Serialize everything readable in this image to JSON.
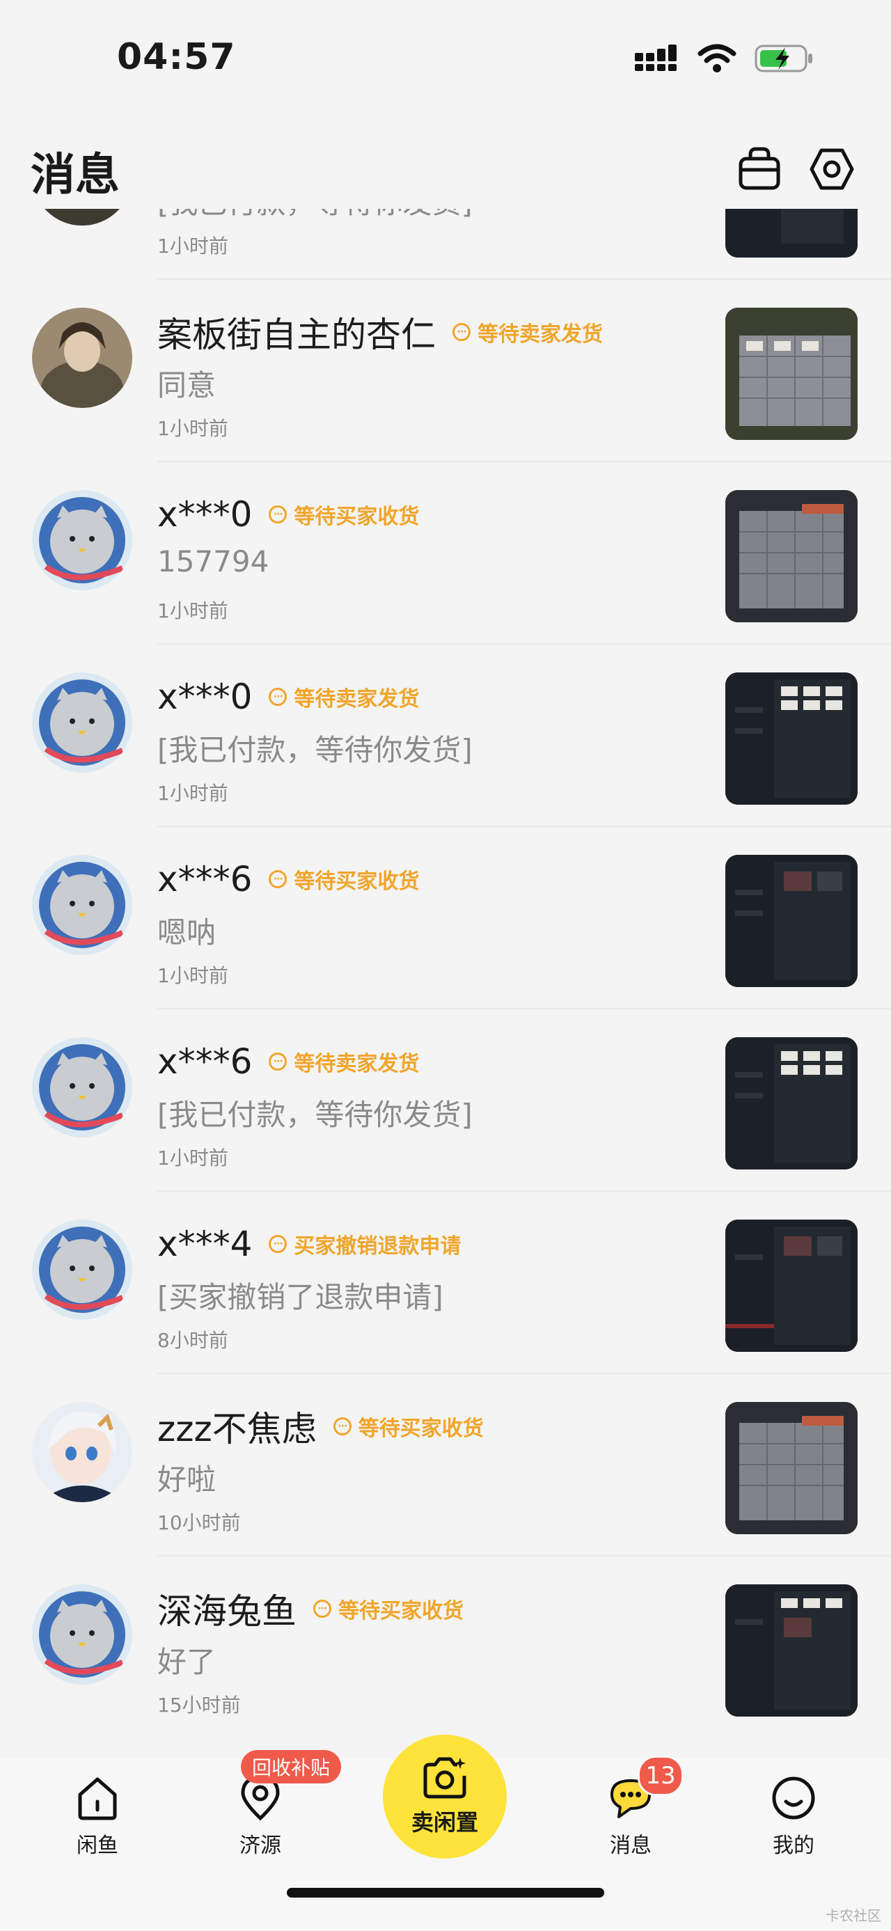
{
  "status_bar": {
    "time": "04:57"
  },
  "header": {
    "title": "消息"
  },
  "messages": [
    {
      "name": "",
      "status": "",
      "preview": "[我已付款，等待你发货]",
      "time": "1小时前",
      "avatar": "photo",
      "thumb": "dark"
    },
    {
      "name": "案板街自主的杏仁",
      "status": "等待卖家发货",
      "preview": "同意",
      "time": "1小时前",
      "avatar": "photo",
      "thumb": "grid"
    },
    {
      "name": "x***0",
      "status": "等待买家收货",
      "preview": "157794",
      "time": "1小时前",
      "avatar": "cat",
      "thumb": "grid"
    },
    {
      "name": "x***0",
      "status": "等待卖家发货",
      "preview": "[我已付款，等待你发货]",
      "time": "1小时前",
      "avatar": "cat",
      "thumb": "dark"
    },
    {
      "name": "x***6",
      "status": "等待买家收货",
      "preview": "嗯呐",
      "time": "1小时前",
      "avatar": "cat",
      "thumb": "dark"
    },
    {
      "name": "x***6",
      "status": "等待卖家发货",
      "preview": "[我已付款，等待你发货]",
      "time": "1小时前",
      "avatar": "cat",
      "thumb": "dark"
    },
    {
      "name": "x***4",
      "status": "买家撤销退款申请",
      "preview": "[买家撤销了退款申请]",
      "time": "8小时前",
      "avatar": "cat",
      "thumb": "dark"
    },
    {
      "name": "zzz不焦虑",
      "status": "等待买家收货",
      "preview": "好啦",
      "time": "10小时前",
      "avatar": "anime",
      "thumb": "grid"
    },
    {
      "name": "深海兔鱼",
      "status": "等待买家收货",
      "preview": "好了",
      "time": "15小时前",
      "avatar": "cat",
      "thumb": "dark"
    }
  ],
  "bottom_nav": {
    "home": "闲鱼",
    "resources": "济源",
    "resources_badge": "回收补贴",
    "sell": "卖闲置",
    "messages": "消息",
    "messages_badge": "13",
    "me": "我的"
  },
  "watermark": "卡农社区",
  "colors": {
    "accent": "#f0a52a",
    "sell_button": "#ffe33b",
    "badge": "#ef5a4b"
  }
}
